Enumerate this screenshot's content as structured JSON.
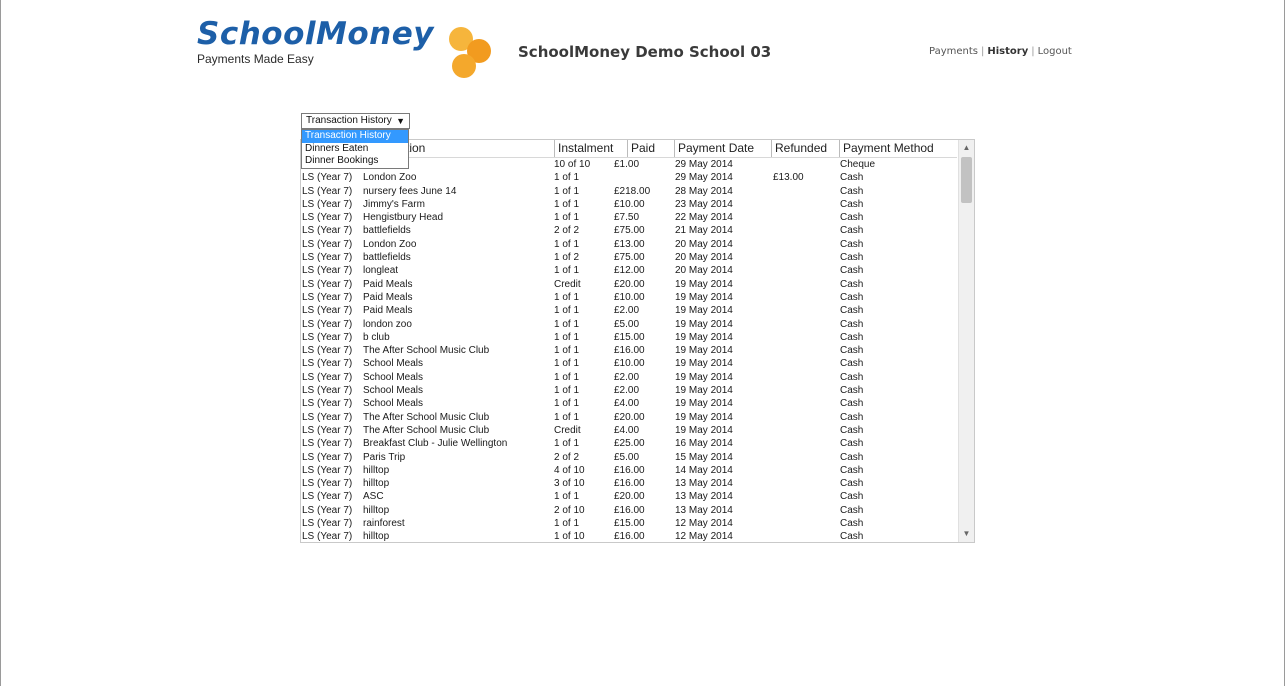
{
  "header": {
    "logo": "SchoolMoney",
    "tagline": "Payments Made Easy",
    "school_name": "SchoolMoney Demo School 03",
    "nav": [
      {
        "label": "Payments"
      },
      {
        "label": "History"
      },
      {
        "label": "Logout"
      }
    ],
    "nav_separator": "|"
  },
  "view_select": {
    "selected": "Transaction History",
    "arrow": "▼",
    "options": [
      "Transaction History",
      "Dinners Eaten",
      "Dinner Bookings"
    ]
  },
  "table": {
    "columns": [
      "Description",
      "Instalment",
      "Paid",
      "Payment Date",
      "Refunded",
      "Payment Method"
    ],
    "visible_header_fragment": "ction",
    "rows": [
      {
        "child": "",
        "desc": "o",
        "inst": "10 of 10",
        "paid": "£1.00",
        "date": "29 May 2014",
        "refunded": "",
        "method": "Cheque"
      },
      {
        "child": "LS (Year 7)",
        "desc": "London Zoo",
        "inst": "1 of 1",
        "paid": "",
        "date": "29 May 2014",
        "refunded": "£13.00",
        "method": "Cash"
      },
      {
        "child": "LS (Year 7)",
        "desc": "nursery fees June 14",
        "inst": "1 of 1",
        "paid": "£218.00",
        "date": "28 May 2014",
        "refunded": "",
        "method": "Cash"
      },
      {
        "child": "LS (Year 7)",
        "desc": "Jimmy's Farm",
        "inst": "1 of 1",
        "paid": "£10.00",
        "date": "23 May 2014",
        "refunded": "",
        "method": "Cash"
      },
      {
        "child": "LS (Year 7)",
        "desc": "Hengistbury Head",
        "inst": "1 of 1",
        "paid": "£7.50",
        "date": "22 May 2014",
        "refunded": "",
        "method": "Cash"
      },
      {
        "child": "LS (Year 7)",
        "desc": "battlefields",
        "inst": "2 of 2",
        "paid": "£75.00",
        "date": "21 May 2014",
        "refunded": "",
        "method": "Cash"
      },
      {
        "child": "LS (Year 7)",
        "desc": "London Zoo",
        "inst": "1 of 1",
        "paid": "£13.00",
        "date": "20 May 2014",
        "refunded": "",
        "method": "Cash"
      },
      {
        "child": "LS (Year 7)",
        "desc": "battlefields",
        "inst": "1 of 2",
        "paid": "£75.00",
        "date": "20 May 2014",
        "refunded": "",
        "method": "Cash"
      },
      {
        "child": "LS (Year 7)",
        "desc": "longleat",
        "inst": "1 of 1",
        "paid": "£12.00",
        "date": "20 May 2014",
        "refunded": "",
        "method": "Cash"
      },
      {
        "child": "LS (Year 7)",
        "desc": "Paid Meals",
        "inst": "Credit",
        "paid": "£20.00",
        "date": "19 May 2014",
        "refunded": "",
        "method": "Cash"
      },
      {
        "child": "LS (Year 7)",
        "desc": "Paid Meals",
        "inst": "1 of 1",
        "paid": "£10.00",
        "date": "19 May 2014",
        "refunded": "",
        "method": "Cash"
      },
      {
        "child": "LS (Year 7)",
        "desc": "Paid Meals",
        "inst": "1 of 1",
        "paid": "£2.00",
        "date": "19 May 2014",
        "refunded": "",
        "method": "Cash"
      },
      {
        "child": "LS (Year 7)",
        "desc": "london zoo",
        "inst": "1 of 1",
        "paid": "£5.00",
        "date": "19 May 2014",
        "refunded": "",
        "method": "Cash"
      },
      {
        "child": "LS (Year 7)",
        "desc": "b club",
        "inst": "1 of 1",
        "paid": "£15.00",
        "date": "19 May 2014",
        "refunded": "",
        "method": "Cash"
      },
      {
        "child": "LS (Year 7)",
        "desc": "The After School Music Club",
        "inst": "1 of 1",
        "paid": "£16.00",
        "date": "19 May 2014",
        "refunded": "",
        "method": "Cash"
      },
      {
        "child": "LS (Year 7)",
        "desc": "School Meals",
        "inst": "1 of 1",
        "paid": "£10.00",
        "date": "19 May 2014",
        "refunded": "",
        "method": "Cash"
      },
      {
        "child": "LS (Year 7)",
        "desc": "School Meals",
        "inst": "1 of 1",
        "paid": "£2.00",
        "date": "19 May 2014",
        "refunded": "",
        "method": "Cash"
      },
      {
        "child": "LS (Year 7)",
        "desc": "School Meals",
        "inst": "1 of 1",
        "paid": "£2.00",
        "date": "19 May 2014",
        "refunded": "",
        "method": "Cash"
      },
      {
        "child": "LS (Year 7)",
        "desc": "School Meals",
        "inst": "1 of 1",
        "paid": "£4.00",
        "date": "19 May 2014",
        "refunded": "",
        "method": "Cash"
      },
      {
        "child": "LS (Year 7)",
        "desc": "The After School Music Club",
        "inst": "1 of 1",
        "paid": "£20.00",
        "date": "19 May 2014",
        "refunded": "",
        "method": "Cash"
      },
      {
        "child": "LS (Year 7)",
        "desc": "The After School Music Club",
        "inst": "Credit",
        "paid": "£4.00",
        "date": "19 May 2014",
        "refunded": "",
        "method": "Cash"
      },
      {
        "child": "LS (Year 7)",
        "desc": "Breakfast Club - Julie Wellington",
        "inst": "1 of 1",
        "paid": "£25.00",
        "date": "16 May 2014",
        "refunded": "",
        "method": "Cash"
      },
      {
        "child": "LS (Year 7)",
        "desc": "Paris Trip",
        "inst": "2 of 2",
        "paid": "£5.00",
        "date": "15 May 2014",
        "refunded": "",
        "method": "Cash"
      },
      {
        "child": "LS (Year 7)",
        "desc": "hilltop",
        "inst": "4 of 10",
        "paid": "£16.00",
        "date": "14 May 2014",
        "refunded": "",
        "method": "Cash"
      },
      {
        "child": "LS (Year 7)",
        "desc": "hilltop",
        "inst": "3 of 10",
        "paid": "£16.00",
        "date": "13 May 2014",
        "refunded": "",
        "method": "Cash"
      },
      {
        "child": "LS (Year 7)",
        "desc": "ASC",
        "inst": "1 of 1",
        "paid": "£20.00",
        "date": "13 May 2014",
        "refunded": "",
        "method": "Cash"
      },
      {
        "child": "LS (Year 7)",
        "desc": "hilltop",
        "inst": "2 of 10",
        "paid": "£16.00",
        "date": "13 May 2014",
        "refunded": "",
        "method": "Cash"
      },
      {
        "child": "LS (Year 7)",
        "desc": "rainforest",
        "inst": "1 of 1",
        "paid": "£15.00",
        "date": "12 May 2014",
        "refunded": "",
        "method": "Cash"
      },
      {
        "child": "LS (Year 7)",
        "desc": "hilltop",
        "inst": "1 of 10",
        "paid": "£16.00",
        "date": "12 May 2014",
        "refunded": "",
        "method": "Cash"
      }
    ]
  },
  "scrollbar": {
    "up_glyph": "▲",
    "down_glyph": "▼"
  },
  "colors": {
    "brand_blue": "#1d5fa8",
    "brand_orange": "#f5a623",
    "selection": "#3399ff"
  }
}
